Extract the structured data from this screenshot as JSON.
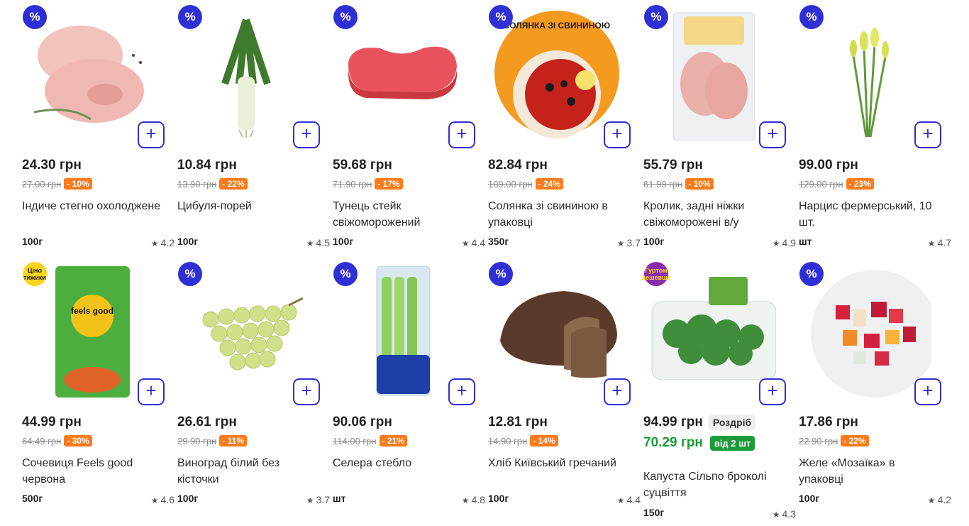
{
  "currency": "грн",
  "products": [
    {
      "name": "Індиче стегно охолоджене",
      "price": "24.30 грн",
      "old_price": "27.00 грн",
      "discount": "- 10%",
      "unit": "100г",
      "rating": "4.2",
      "badge": "%",
      "badge_icon": "percent-icon"
    },
    {
      "name": "Цибуля-порей",
      "price": "10.84 грн",
      "old_price": "13.90 грн",
      "discount": "- 22%",
      "unit": "100г",
      "rating": "4.5",
      "badge": "%",
      "badge_icon": "percent-icon"
    },
    {
      "name": "Тунець стейк свіжоморожений",
      "price": "59.68 грн",
      "old_price": "71.90 грн",
      "discount": "- 17%",
      "unit": "100г",
      "rating": "4.4",
      "badge": "%",
      "badge_icon": "percent-icon"
    },
    {
      "name": "Солянка зі свининою в упаковці",
      "price": "82.84 грн",
      "old_price": "109.00 грн",
      "discount": "- 24%",
      "unit": "350г",
      "rating": "3.7",
      "badge": "%",
      "badge_icon": "percent-icon",
      "package_label": "СОЛЯНКА ЗІ СВИНИНОЮ"
    },
    {
      "name": "Кролик, задні ніжки свіжоморожені в/у",
      "price": "55.79 грн",
      "old_price": "61.99 грн",
      "discount": "- 10%",
      "unit": "100г",
      "rating": "4.9",
      "badge": "%",
      "badge_icon": "percent-icon"
    },
    {
      "name": "Нарцис фермерський, 10 шт.",
      "price": "99.00 грн",
      "old_price": "129.00 грн",
      "discount": "- 23%",
      "unit": "шт",
      "rating": "4.7",
      "badge": "%",
      "badge_icon": "percent-icon"
    },
    {
      "name": "Сочевиця Feels good червона",
      "price": "44.99 грн",
      "old_price": "64.49 грн",
      "discount": "- 30%",
      "unit": "500г",
      "rating": "4.6",
      "badge": "Ціно тижики",
      "badge_icon": "tsino-tyzhyky-badge",
      "package_label": "feels good"
    },
    {
      "name": "Виноград білий без кісточки",
      "price": "26.61 грн",
      "old_price": "29.90 грн",
      "discount": "- 11%",
      "unit": "100г",
      "rating": "3.7",
      "badge": "%",
      "badge_icon": "percent-icon"
    },
    {
      "name": "Селера стебло",
      "price": "90.06 грн",
      "old_price": "114.00 грн",
      "discount": "- 21%",
      "unit": "шт",
      "rating": "4.8",
      "badge": "%",
      "badge_icon": "percent-icon"
    },
    {
      "name": "Хліб Київський гречаний",
      "price": "12.81 грн",
      "old_price": "14.90 грн",
      "discount": "- 14%",
      "unit": "100г",
      "rating": "4.4",
      "badge": "%",
      "badge_icon": "percent-icon"
    },
    {
      "name": "Капуста Сільпо броколі суцвіття",
      "price": "94.99 грн",
      "retail_label": "Роздріб",
      "wholesale_price": "70.29 грн",
      "wholesale_label": "від 2 шт",
      "unit": "150г",
      "rating": "4.3",
      "badge": "Гуртом дешевше",
      "badge_icon": "hurtom-deshevshe-badge"
    },
    {
      "name": "Желе «Мозаїка» в упаковці",
      "price": "17.86 грн",
      "old_price": "22.90 грн",
      "discount": "- 22%",
      "unit": "100г",
      "rating": "4.2",
      "badge": "%",
      "badge_icon": "percent-icon"
    }
  ],
  "colors": {
    "accent": "#2f2fd6",
    "discount": "#ff7a1a",
    "wholesale": "#1b9b3a",
    "tsino": "#ffd51e",
    "hurtom": "#8a2ca8"
  }
}
